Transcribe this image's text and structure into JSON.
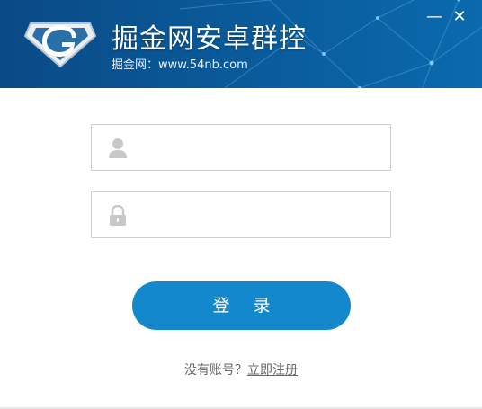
{
  "header": {
    "title": "掘金网安卓群控",
    "subtitle": "掘金网：www.54nb.com",
    "minimize_glyph": "—",
    "close_glyph": "✕"
  },
  "form": {
    "username": {
      "value": "",
      "placeholder": "",
      "icon": "user-icon"
    },
    "password": {
      "value": "",
      "placeholder": "",
      "icon": "lock-icon"
    },
    "login_label": "登 录"
  },
  "register": {
    "prompt": "没有账号？",
    "link_label": "立即注册"
  },
  "colors": {
    "header_bg": "#0a5796",
    "button_bg": "#1488cc",
    "icon_gray": "#c8c8c8"
  }
}
